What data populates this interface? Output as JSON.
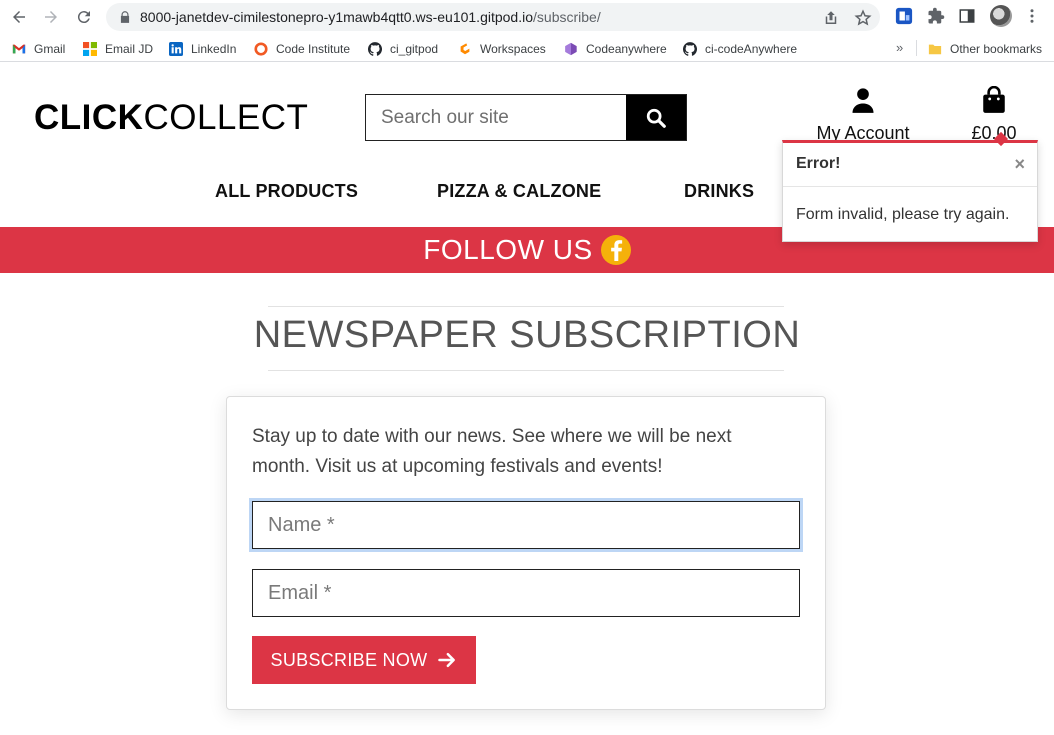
{
  "browser": {
    "url_host": "8000-janetdev-cimilestonepro-y1mawb4qtt0.ws-eu101.gitpod.io",
    "url_path": "/subscribe/",
    "bookmarks": [
      {
        "label": "Gmail",
        "icon": "gmail-icon"
      },
      {
        "label": "Email JD",
        "icon": "microsoft-icon"
      },
      {
        "label": "LinkedIn",
        "icon": "linkedin-icon"
      },
      {
        "label": "Code Institute",
        "icon": "code-institute-icon"
      },
      {
        "label": "ci_gitpod",
        "icon": "github-icon"
      },
      {
        "label": "Workspaces",
        "icon": "gitpod-icon"
      },
      {
        "label": "Codeanywhere",
        "icon": "codeanywhere-icon"
      },
      {
        "label": "ci-codeAnywhere",
        "icon": "github-icon"
      }
    ],
    "more_bookmarks": "»",
    "other_bookmarks": "Other bookmarks"
  },
  "site": {
    "logo_bold": "CLICK",
    "logo_light": "COLLECT",
    "search_placeholder": "Search our site",
    "account_label": "My Account",
    "bag_total": "£0.00",
    "nav": [
      "ALL PRODUCTS",
      "PIZZA & CALZONE",
      "DRINKS"
    ],
    "banner_text": "FOLLOW US",
    "accent": "#dc3545"
  },
  "toast": {
    "title": "Error!",
    "close": "×",
    "message": "Form invalid, please try again."
  },
  "page": {
    "title": "NEWSPAPER SUBSCRIPTION",
    "intro": "Stay up to date with our news. See where we will be next month. Visit us at upcoming festivals and events!",
    "name_placeholder": "Name *",
    "email_placeholder": "Email *",
    "submit_label": "SUBSCRIBE NOW"
  }
}
